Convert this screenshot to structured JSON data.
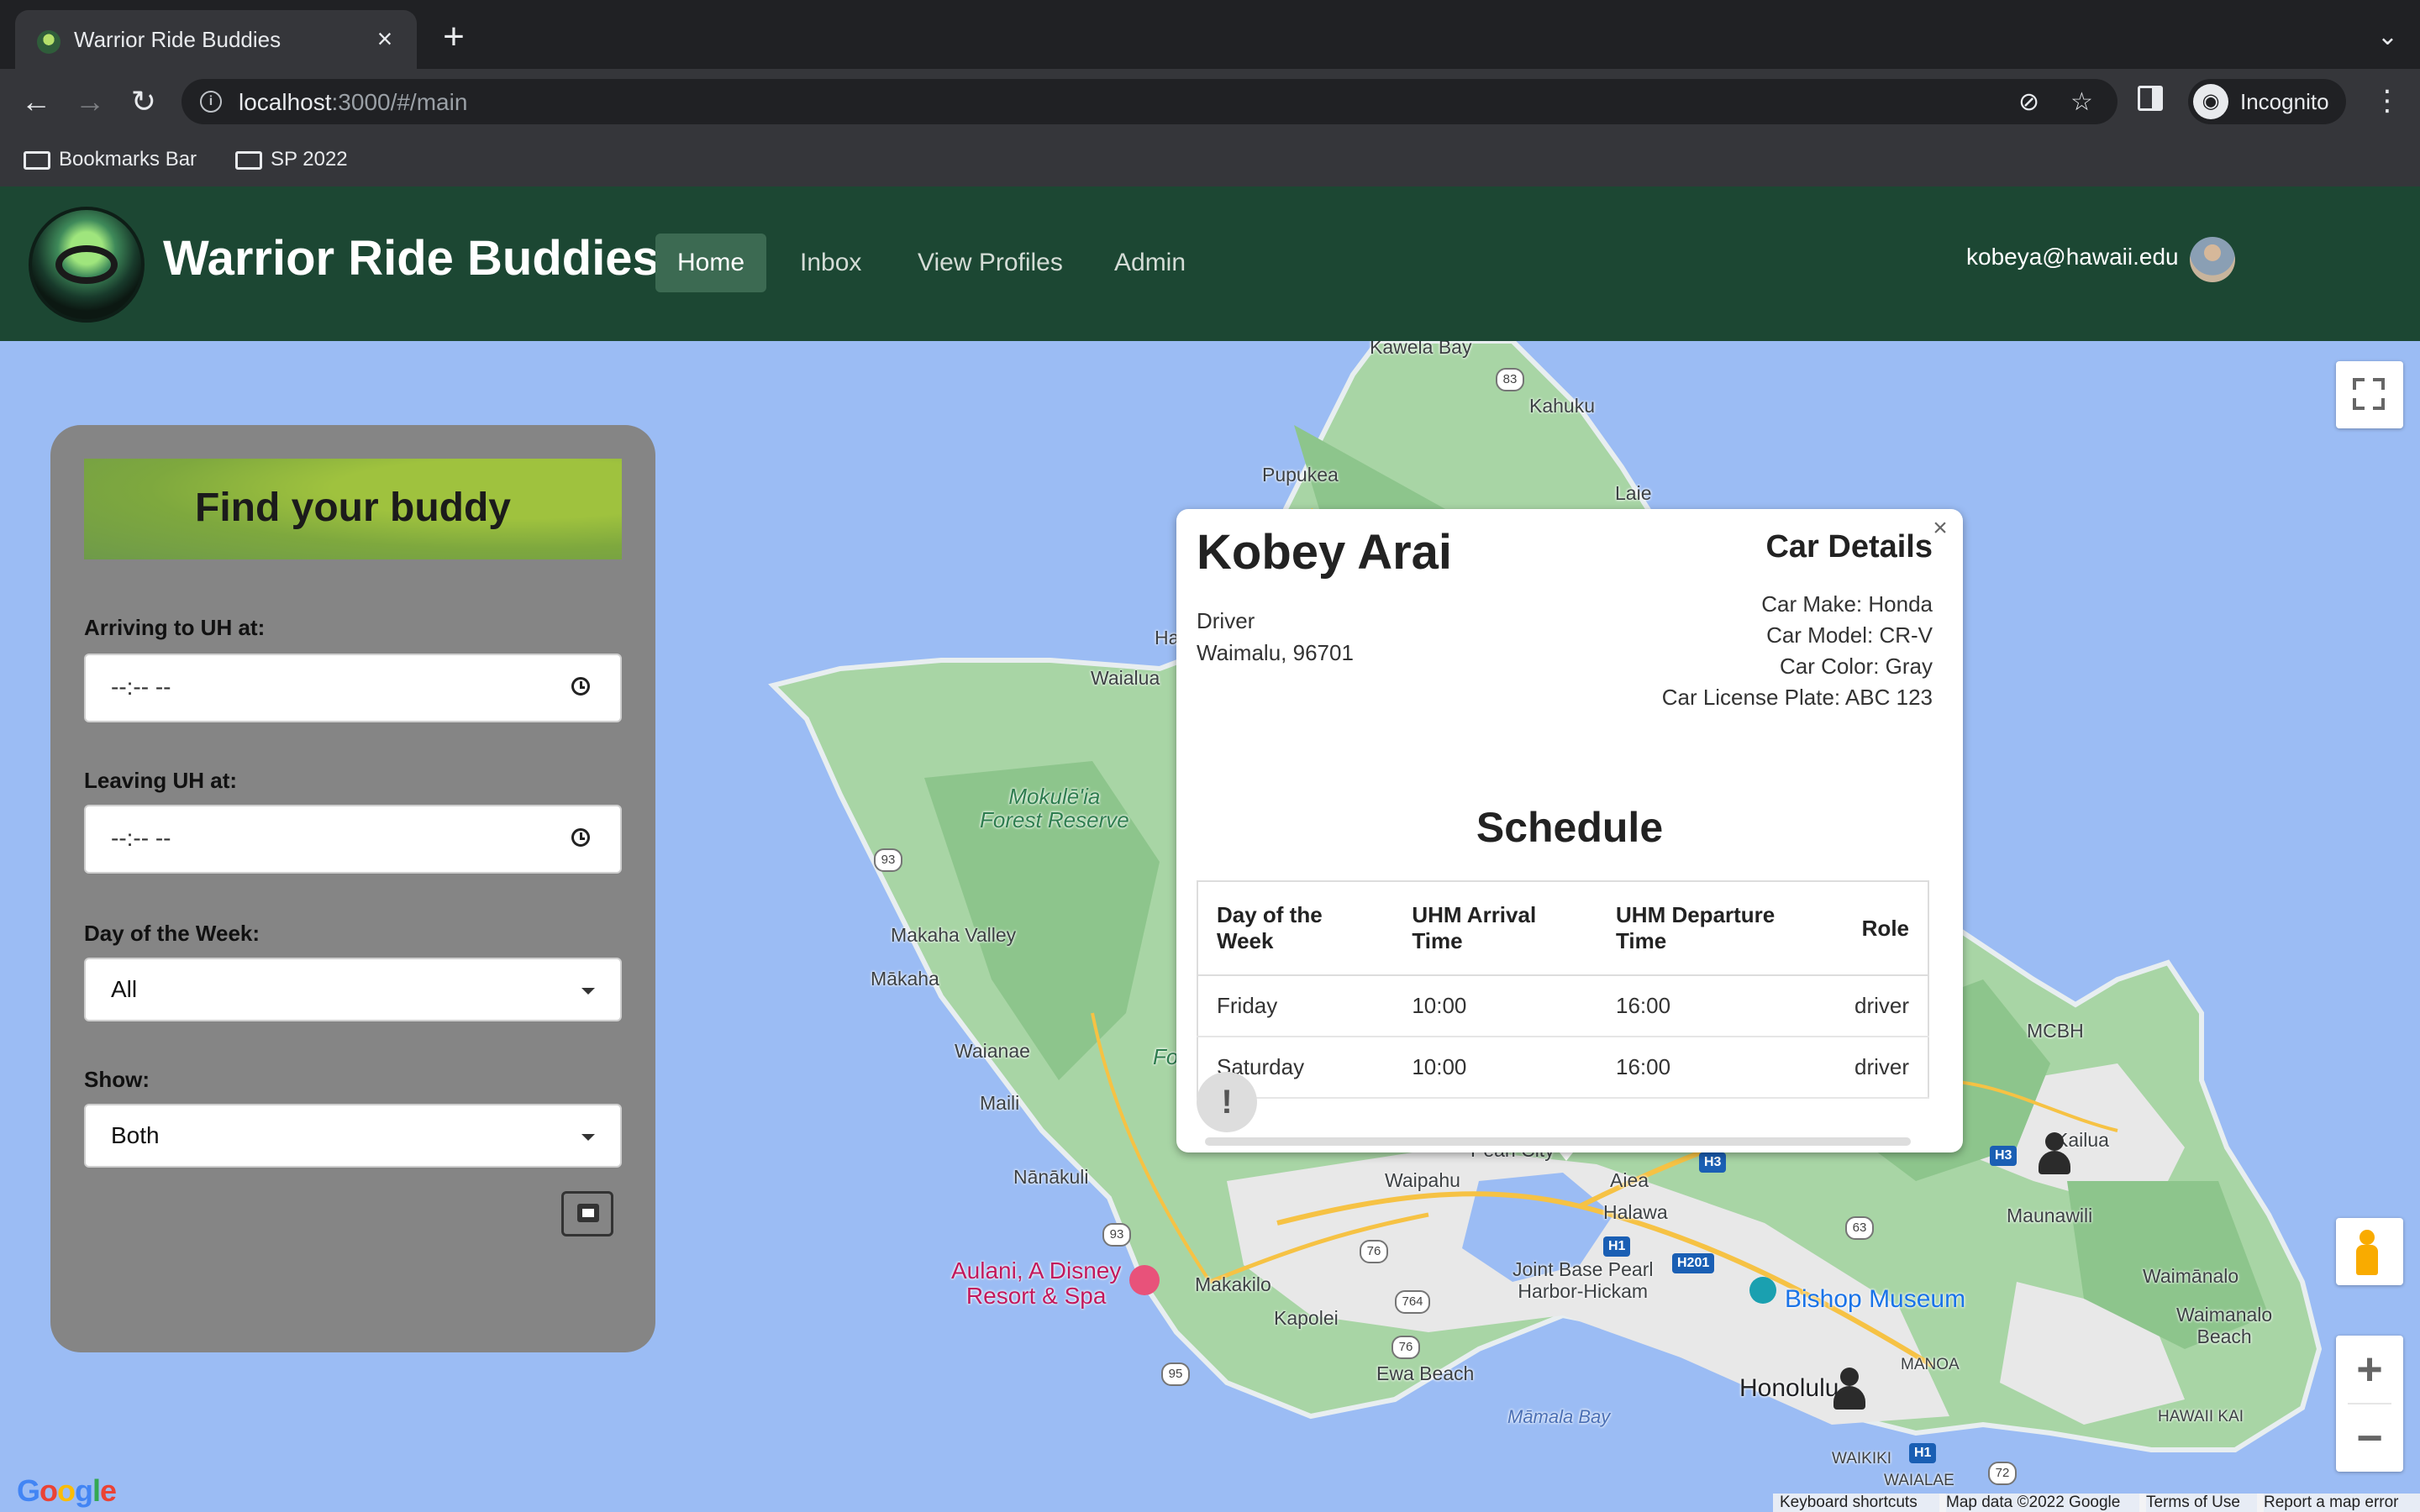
{
  "browser": {
    "tab_title": "Warrior Ride Buddies",
    "url_host": "localhost",
    "url_rest": ":3000/#/main",
    "profile_label": "Incognito",
    "bookmarks": [
      "Bookmarks Bar",
      "SP 2022"
    ]
  },
  "navbar": {
    "brand": "Warrior Ride Buddies",
    "links": [
      "Home",
      "Inbox",
      "View Profiles",
      "Admin"
    ],
    "active_link": "Home",
    "user_email": "kobeya@hawaii.edu"
  },
  "filter": {
    "title": "Find your buddy",
    "arriving_label": "Arriving to UH at:",
    "arriving_value": "--:-- --",
    "leaving_label": "Leaving UH at:",
    "leaving_value": "--:-- --",
    "day_label": "Day of the Week:",
    "day_value": "All",
    "show_label": "Show:",
    "show_value": "Both"
  },
  "popup": {
    "name": "Kobey Arai",
    "role": "Driver",
    "location": "Waimalu, 96701",
    "car_details_title": "Car Details",
    "car_make": "Car Make: Honda",
    "car_model": "Car Model: CR-V",
    "car_color": "Car Color: Gray",
    "car_plate": "Car License Plate: ABC 123",
    "schedule_title": "Schedule",
    "table_headers": [
      "Day of the Week",
      "UHM Arrival Time",
      "UHM Departure Time",
      "Role"
    ],
    "rows": [
      [
        "Friday",
        "10:00",
        "16:00",
        "driver"
      ],
      [
        "Saturday",
        "10:00",
        "16:00",
        "driver"
      ]
    ],
    "alert_symbol": "!"
  },
  "map": {
    "places": {
      "kawela_bay": "Kawela Bay",
      "kahuku": "Kahuku",
      "pupukea": "Pupukea",
      "laie": "Laie",
      "waialua": "Waialua",
      "ha": "Ha",
      "mokuleia": "Mokulē'ia\nForest Reserve",
      "makaha_valley": "Makaha Valley",
      "makaha": "Mākaha",
      "waianae": "Waianae",
      "maili": "Maili",
      "nanakuli": "Nānākuli",
      "fo": "Fo",
      "pearl_city": "Pearl City",
      "waipahu": "Waipahu",
      "aiea": "Aiea",
      "halawa": "Halawa",
      "makakilo": "Makakilo",
      "kapolei": "Kapolei",
      "ewa_beach": "Ewa Beach",
      "mamala_bay": "Māmala Bay",
      "joint_base": "Joint Base Pearl\nHarbor-Hickam",
      "bishop_museum": "Bishop Museum",
      "honolulu": "Honolulu",
      "manoa": "MANOA",
      "waikiki": "WAIKIKI",
      "waialae": "WAIALAE",
      "hawaii_kai": "HAWAII KAI",
      "maunawili": "Maunawili",
      "waimanalo": "Waimānalo",
      "waimanalo_beach": "Waimanalo\nBeach",
      "kailua": "Kailua",
      "mcbh": "MCBH",
      "aulani": "Aulani, A Disney\nResort & Spa"
    },
    "route_shields": [
      "83",
      "93",
      "93",
      "95",
      "76",
      "764",
      "76",
      "63",
      "72"
    ],
    "highway_shields": [
      "H3",
      "H1",
      "H201",
      "H3",
      "H1"
    ],
    "google_logo": "Google",
    "attribution": [
      "Keyboard shortcuts",
      "Map data ©2022 Google",
      "Terms of Use",
      "Report a map error"
    ]
  },
  "colors": {
    "navbar_bg": "#1c4733",
    "water": "#9bbcf4",
    "land": "#a8d5a5",
    "panel_bg": "#858585"
  }
}
